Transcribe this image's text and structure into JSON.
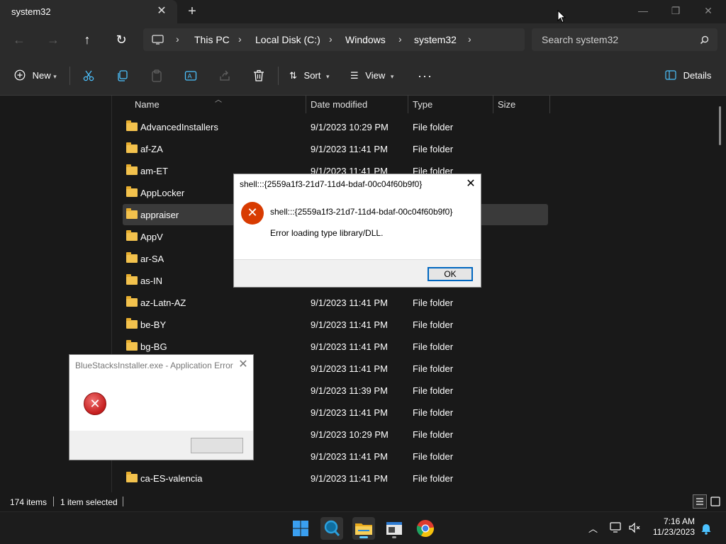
{
  "window": {
    "tab_title": "system32",
    "tab_close": "✕",
    "new_tab": "+",
    "minimize": "—",
    "maximize": "❐",
    "close": "✕"
  },
  "nav": {
    "back": "←",
    "forward": "→",
    "up": "↑",
    "refresh": "↻",
    "breadcrumbs": [
      "This PC",
      "Local Disk (C:)",
      "Windows",
      "system32"
    ],
    "search_placeholder": "Search system32"
  },
  "commands": {
    "new_label": "New",
    "sort_label": "Sort",
    "view_label": "View",
    "details_label": "Details"
  },
  "columns": {
    "name": "Name",
    "date": "Date modified",
    "type": "Type",
    "size": "Size"
  },
  "files": [
    {
      "name": "AdvancedInstallers",
      "date": "9/1/2023 10:29 PM",
      "type": "File folder"
    },
    {
      "name": "af-ZA",
      "date": "9/1/2023 11:41 PM",
      "type": "File folder"
    },
    {
      "name": "am-ET",
      "date": "9/1/2023 11:41 PM",
      "type": "File folder"
    },
    {
      "name": "AppLocker",
      "date": "",
      "type": ""
    },
    {
      "name": "appraiser",
      "date": "",
      "type": ""
    },
    {
      "name": "AppV",
      "date": "",
      "type": ""
    },
    {
      "name": "ar-SA",
      "date": "",
      "type": ""
    },
    {
      "name": "as-IN",
      "date": "",
      "type": ""
    },
    {
      "name": "az-Latn-AZ",
      "date": "9/1/2023 11:41 PM",
      "type": "File folder"
    },
    {
      "name": "be-BY",
      "date": "9/1/2023 11:41 PM",
      "type": "File folder"
    },
    {
      "name": "bg-BG",
      "date": "9/1/2023 11:41 PM",
      "type": "File folder"
    },
    {
      "name": "",
      "date": "9/1/2023 11:41 PM",
      "type": "File folder"
    },
    {
      "name": "",
      "date": "9/1/2023 11:39 PM",
      "type": "File folder"
    },
    {
      "name": "",
      "date": "9/1/2023 11:41 PM",
      "type": "File folder"
    },
    {
      "name": "",
      "date": "9/1/2023 10:29 PM",
      "type": "File folder"
    },
    {
      "name": "",
      "date": "9/1/2023 11:41 PM",
      "type": "File folder"
    },
    {
      "name": "ca-ES-valencia",
      "date": "9/1/2023 11:41 PM",
      "type": "File folder"
    }
  ],
  "status": {
    "items": "174 items",
    "selected": "1 item selected"
  },
  "dialog_shell": {
    "title": "shell:::{2559a1f3-21d7-11d4-bdaf-00c04f60b9f0}",
    "message1": "shell:::{2559a1f3-21d7-11d4-bdaf-00c04f60b9f0}",
    "message2": "Error loading type library/DLL.",
    "ok": "OK",
    "close": "✕"
  },
  "dialog_app": {
    "title": "BlueStacksInstaller.exe - Application Error",
    "close": "✕"
  },
  "taskbar": {
    "time": "7:16 AM",
    "date": "11/23/2023"
  }
}
